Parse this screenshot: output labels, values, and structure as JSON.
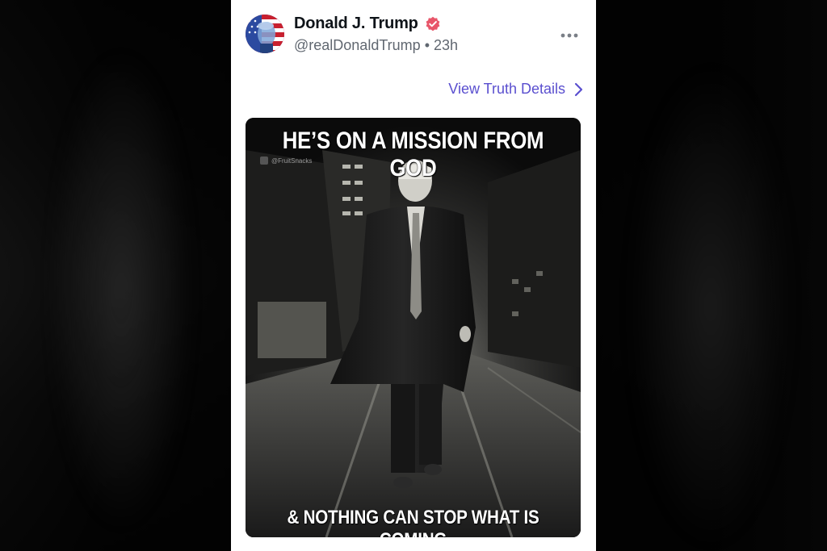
{
  "post": {
    "author_name": "Donald J. Trump",
    "author_handle": "@realDonaldTrump",
    "separator": "•",
    "time_ago": "23h",
    "details_link": "View Truth Details",
    "more_icon": "more-horizontal-icon",
    "verified_icon": "verified-badge-icon"
  },
  "media": {
    "caption_top": "HE’S ON A MISSION FROM GOD",
    "caption_bottom": "& NOTHING CAN STOP WHAT IS COMING",
    "watermark": "@FruitSnacks"
  },
  "colors": {
    "link": "#5a4fcf",
    "verified": "#e8566a",
    "name": "#0f1419",
    "handle": "#606770"
  }
}
